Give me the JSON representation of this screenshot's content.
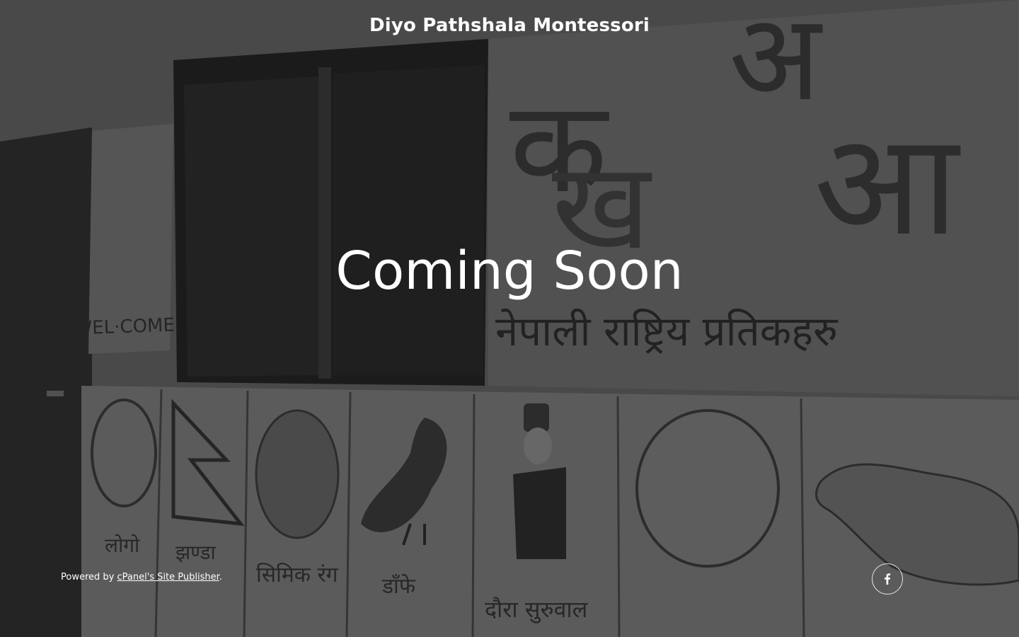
{
  "header": {
    "site_title": "Diyo Pathshala Montessori"
  },
  "hero": {
    "heading": "Coming Soon"
  },
  "footer": {
    "powered_prefix": "Powered by ",
    "powered_link": "cPanel's Site Publisher",
    "powered_suffix": "."
  },
  "social": {
    "icon": "facebook-icon"
  },
  "mural": {
    "label_welcome": "WEL·COME",
    "heading_np": "नेपाली राष्ट्रिय प्रतिकहरु",
    "letters": [
      "क",
      "ख",
      "अ",
      "आ"
    ],
    "caption_1": "लोगो",
    "caption_2": "झण्डा",
    "caption_3": "सिमिक रंग",
    "caption_4": "डाँफे",
    "caption_5": "दौरा सुरुवाल"
  }
}
